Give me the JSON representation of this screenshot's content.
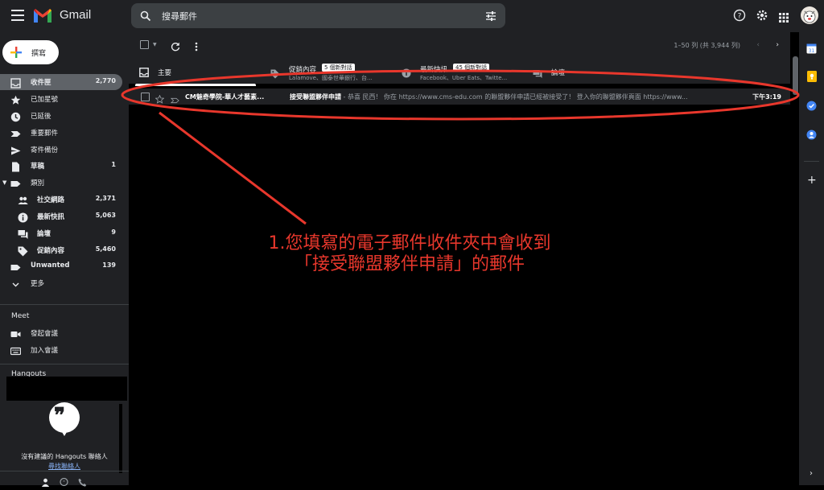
{
  "app": {
    "name": "Gmail"
  },
  "search": {
    "placeholder": "搜尋郵件"
  },
  "compose": {
    "label": "撰寫"
  },
  "sidebar": {
    "items": [
      {
        "label": "收件匣",
        "count": "2,770"
      },
      {
        "label": "已加星號",
        "count": ""
      },
      {
        "label": "已延後",
        "count": ""
      },
      {
        "label": "重要郵件",
        "count": ""
      },
      {
        "label": "寄件備份",
        "count": ""
      },
      {
        "label": "草稿",
        "count": "1"
      },
      {
        "label": "類別",
        "count": ""
      },
      {
        "label": "社交網路",
        "count": "2,371"
      },
      {
        "label": "最新快訊",
        "count": "5,063"
      },
      {
        "label": "論壇",
        "count": "9"
      },
      {
        "label": "促銷內容",
        "count": "5,460"
      },
      {
        "label": "Unwanted",
        "count": "139"
      },
      {
        "label": "更多",
        "count": ""
      }
    ]
  },
  "meet": {
    "title": "Meet",
    "start": "發起會議",
    "join": "加入會議"
  },
  "hangouts": {
    "title": "Hangouts",
    "empty_text": "沒有建議的 Hangouts 聯絡人",
    "find_link": "尋找聯絡人"
  },
  "toolbar": {
    "pagination": "1–50 列 (共 3,944 列)"
  },
  "tabs": [
    {
      "label": "主要",
      "badge": "",
      "sub": ""
    },
    {
      "label": "促銷內容",
      "badge": "5 個新對話",
      "sub": "Lalamove、國泰世華銀行、台..."
    },
    {
      "label": "最新快訊",
      "badge": "45 個新對話",
      "sub": "Facebook、Uber Eats、Twitte..."
    },
    {
      "label": "論壇",
      "badge": "",
      "sub": ""
    }
  ],
  "email": {
    "sender": "CM魅奇學院-華人才藝素...",
    "subject": "接受聯盟夥伴申請",
    "snippet": " - 恭喜 民西！ 你在 https://www.cms-edu.com 的聯盟夥伴申請已經被接受了！ 登入你的聯盟夥伴頁面 https://www...",
    "time": "下午3:19"
  },
  "annotation": {
    "line1": "1.您填寫的電子郵件收件夾中會收到",
    "line2": "「接受聯盟夥伴申請」的郵件"
  },
  "colors": {
    "accent_red": "#e8372c",
    "bg": "#202124",
    "selected": "#5f6368"
  }
}
